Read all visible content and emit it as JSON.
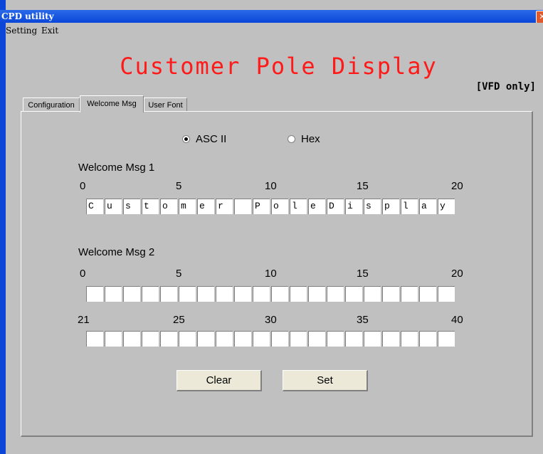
{
  "window": {
    "title": "CPD utility"
  },
  "menu": [
    "Setting",
    "Exit"
  ],
  "app_title": "Customer Pole Display",
  "vfd_note": "[VFD only]",
  "tabs": [
    "Configuration",
    "Welcome Msg",
    "User Font"
  ],
  "encoding": {
    "ascii_label": "ASC II",
    "hex_label": "Hex",
    "selected": "ASC II"
  },
  "msg1": {
    "title": "Welcome Msg 1",
    "indices": [
      "0",
      "5",
      "10",
      "15",
      "20"
    ],
    "cells": [
      "C",
      "u",
      "s",
      "t",
      "o",
      "m",
      "e",
      "r",
      "",
      "P",
      "o",
      "l",
      "e",
      "D",
      "i",
      "s",
      "p",
      "l",
      "a",
      "y"
    ]
  },
  "msg2": {
    "title": "Welcome Msg 2",
    "indices_row1": [
      "0",
      "5",
      "10",
      "15",
      "20"
    ],
    "indices_row2": [
      "21",
      "25",
      "30",
      "35",
      "40"
    ],
    "cells_row1": [
      "",
      "",
      "",
      "",
      "",
      "",
      "",
      "",
      "",
      "",
      "",
      "",
      "",
      "",
      "",
      "",
      "",
      "",
      "",
      ""
    ],
    "cells_row2": [
      "",
      "",
      "",
      "",
      "",
      "",
      "",
      "",
      "",
      "",
      "",
      "",
      "",
      "",
      "",
      "",
      "",
      "",
      "",
      ""
    ]
  },
  "buttons": {
    "clear": "Clear",
    "set": "Set"
  }
}
